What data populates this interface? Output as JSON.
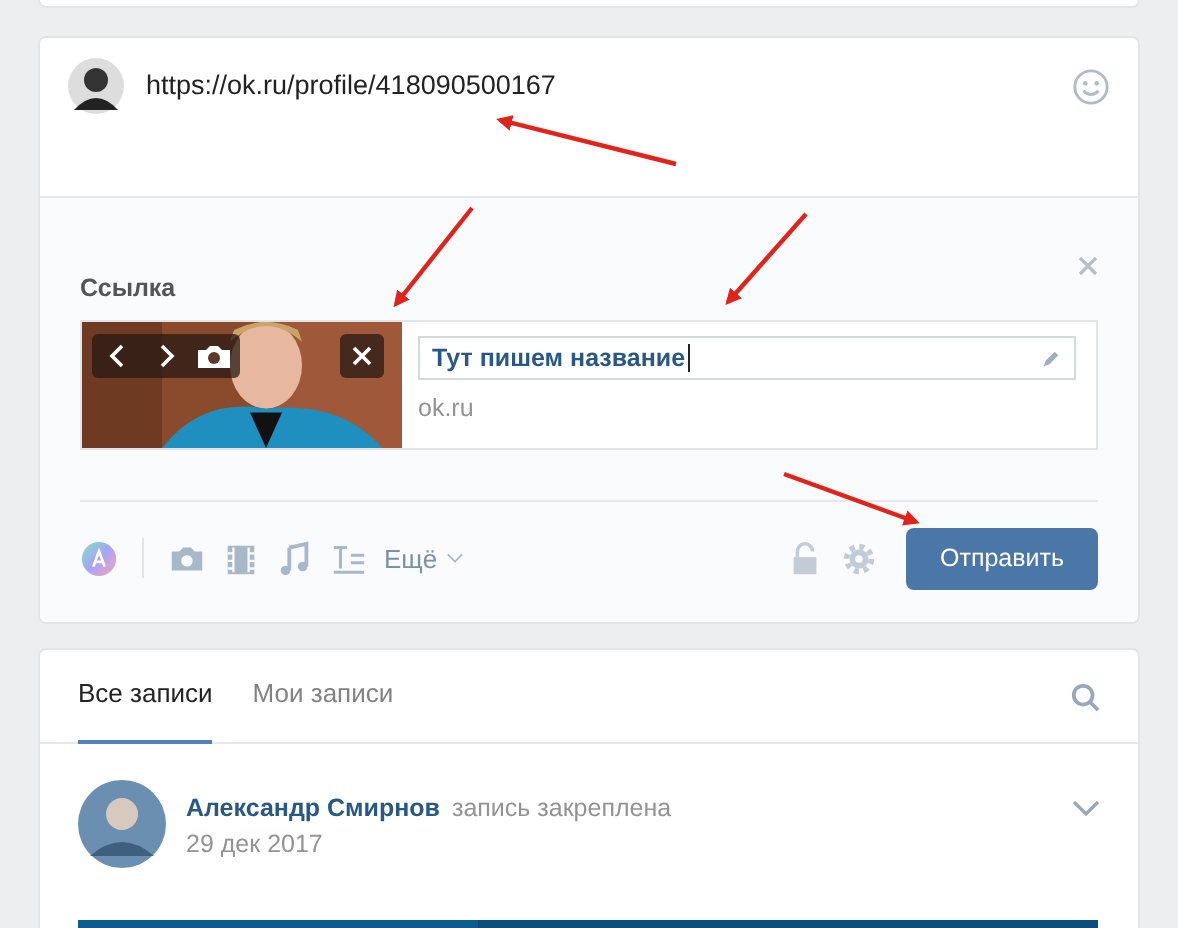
{
  "composer": {
    "text": "https://ok.ru/profile/418090500167",
    "attachment": {
      "heading": "Ссылка",
      "title": "Тут пишем название",
      "domain": "ok.ru"
    },
    "toolbar": {
      "more": "Ещё"
    },
    "submit": "Отправить"
  },
  "wall": {
    "tabs": [
      {
        "label": "Все записи",
        "selected": true
      },
      {
        "label": "Мои записи",
        "selected": false
      }
    ],
    "post": {
      "author": "Александр Смирнов",
      "note": "запись закреплена",
      "date": "29 дек 2017"
    }
  }
}
